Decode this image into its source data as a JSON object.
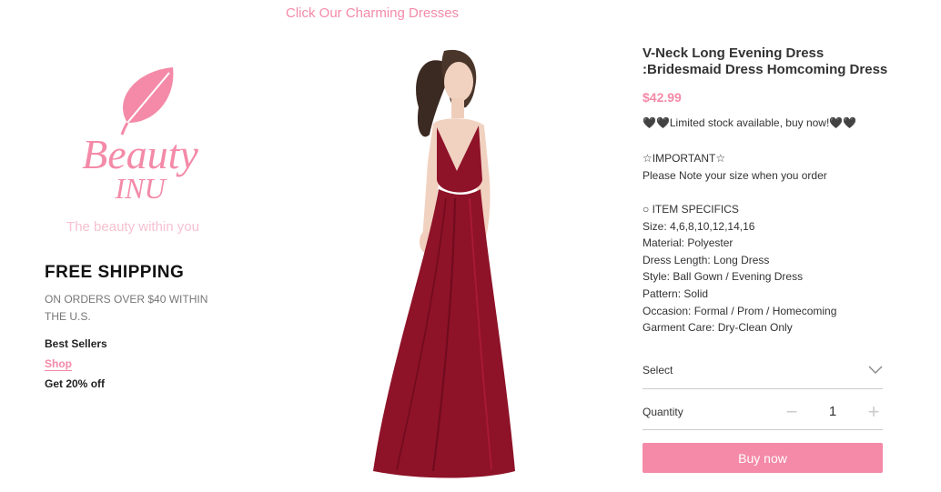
{
  "header": {
    "link_label": "Click Our Charming Dresses"
  },
  "logo": {
    "word1": "Beauty",
    "word2": "INU",
    "tagline": "The beauty within you"
  },
  "left": {
    "shipping_title": "FREE SHIPPING",
    "shipping_sub": "ON ORDERS OVER $40 WITHIN THE U.S.",
    "links": {
      "best_sellers": "Best Sellers",
      "shop": "Shop",
      "discount": "Get 20% off"
    }
  },
  "product": {
    "title": "V-Neck Long Evening Dress :Bridesmaid Dress Homcoming Dress",
    "price": "$42.99",
    "stock": "🖤🖤Limited stock available, buy now!🖤🖤",
    "important_title": "☆IMPORTANT☆",
    "important_note": "Please Note your size when you order",
    "specs": [
      "○ ITEM SPECIFICS",
      "Size: 4,6,8,10,12,14,16",
      "Material: Polyester",
      "Dress Length: Long Dress",
      "Style: Ball Gown / Evening Dress",
      "Pattern: Solid",
      "Occasion: Formal / Prom / Homecoming",
      "Garment Care: Dry-Clean Only"
    ],
    "select_label": "Select",
    "quantity_label": "Quantity",
    "quantity_minus": "−",
    "quantity_value": "1",
    "quantity_plus": "+",
    "buy_label": "Buy now"
  },
  "colors": {
    "accent": "#f48aa8",
    "dress": "#8e1228"
  },
  "icons": {
    "select": "chevron-down-icon",
    "logo": "leaf-icon"
  }
}
